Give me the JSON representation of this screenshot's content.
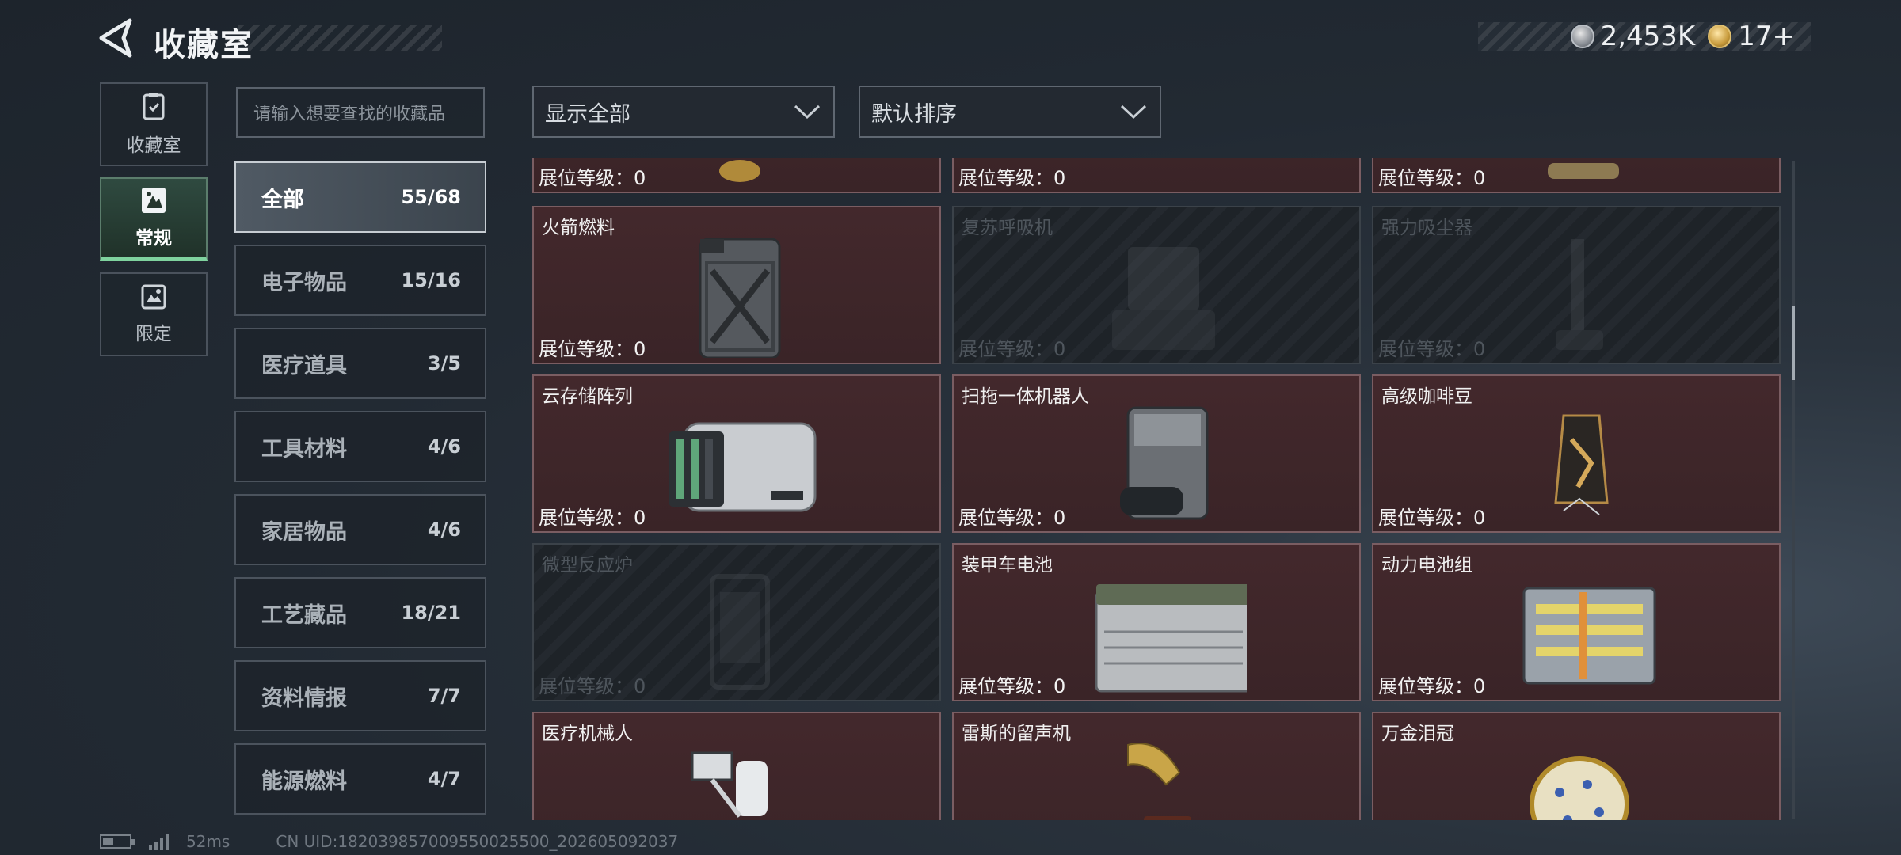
{
  "header": {
    "title": "收藏室",
    "currency": [
      {
        "icon": "silver-coin-icon",
        "value": "2,453K"
      },
      {
        "icon": "gold-coin-icon",
        "value": "17+"
      }
    ]
  },
  "side_tabs": [
    {
      "label": "收藏室",
      "icon": "collection-room-icon",
      "active": false
    },
    {
      "label": "常规",
      "icon": "regular-icon",
      "active": true
    },
    {
      "label": "限定",
      "icon": "limited-icon",
      "active": false
    }
  ],
  "search": {
    "placeholder": "请输入想要查找的收藏品"
  },
  "categories": [
    {
      "name": "全部",
      "count": "55/68",
      "active": true
    },
    {
      "name": "电子物品",
      "count": "15/16"
    },
    {
      "name": "医疗道具",
      "count": "3/5"
    },
    {
      "name": "工具材料",
      "count": "4/6"
    },
    {
      "name": "家居物品",
      "count": "4/6"
    },
    {
      "name": "工艺藏品",
      "count": "18/21"
    },
    {
      "name": "资料情报",
      "count": "7/7"
    },
    {
      "name": "能源燃料",
      "count": "4/7"
    }
  ],
  "filters": {
    "show": "显示全部",
    "sort": "默认排序"
  },
  "level_label": "展位等级：0",
  "items": [
    {
      "name": "",
      "locked": false
    },
    {
      "name": "",
      "locked": false
    },
    {
      "name": "",
      "locked": false
    },
    {
      "name": "火箭燃料",
      "locked": false
    },
    {
      "name": "复苏呼吸机",
      "locked": true
    },
    {
      "name": "强力吸尘器",
      "locked": true
    },
    {
      "name": "云存储阵列",
      "locked": false
    },
    {
      "name": "扫拖一体机器人",
      "locked": false
    },
    {
      "name": "高级咖啡豆",
      "locked": false
    },
    {
      "name": "微型反应炉",
      "locked": true
    },
    {
      "name": "装甲车电池",
      "locked": false
    },
    {
      "name": "动力电池组",
      "locked": false
    },
    {
      "name": "医疗机械人",
      "locked": false
    },
    {
      "name": "雷斯的留声机",
      "locked": false
    },
    {
      "name": "万金泪冠",
      "locked": false
    }
  ],
  "status": {
    "ping": "52ms",
    "uid": "CN UID:18203985700955002550​0_202605092037",
    "battery_level": 0.4
  }
}
